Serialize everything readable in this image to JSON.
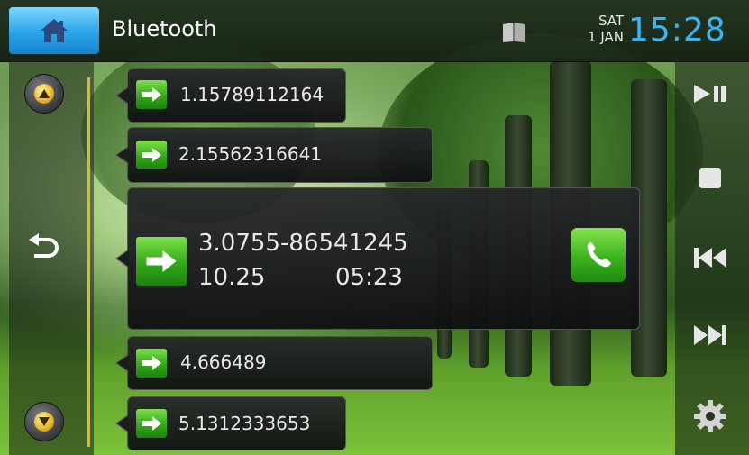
{
  "header": {
    "title": "Bluetooth",
    "day": "SAT",
    "date": "1 JAN",
    "time": "15:28"
  },
  "colors": {
    "accent_blue": "#35b6f3",
    "call_green": "#3cb21e",
    "scroll_line": "#e4b62a"
  },
  "icons": {
    "home": "home-icon",
    "book": "phonebook-icon",
    "up": "arrow-up-icon",
    "down": "arrow-down-icon",
    "back": "back-icon",
    "play_pause": "play-pause-icon",
    "stop": "stop-icon",
    "prev": "previous-track-icon",
    "next": "next-track-icon",
    "settings": "gear-icon",
    "outgoing": "right-arrow-icon",
    "call": "phone-icon"
  },
  "calls": [
    {
      "number": "1.15789112164"
    },
    {
      "number": "2.15562316641"
    },
    {
      "number": "3.0755-86541245",
      "date": "10.25",
      "time": "05:23"
    },
    {
      "number": "4.666489"
    },
    {
      "number": "5.1312333653"
    }
  ]
}
